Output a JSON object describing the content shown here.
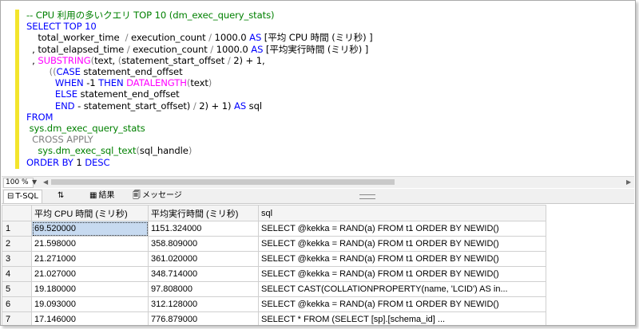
{
  "editor": {
    "lines": [
      [
        {
          "t": "-- CPU 利用の多いクエリ TOP 10 (dm_exec_query_stats)",
          "c": "c"
        }
      ],
      [
        {
          "t": "SELECT TOP 10",
          "c": "k"
        }
      ],
      [
        {
          "t": "    total_worker_time  ",
          "c": ""
        },
        {
          "t": "/",
          "c": "g"
        },
        {
          "t": " execution_count ",
          "c": ""
        },
        {
          "t": "/",
          "c": "g"
        },
        {
          "t": " 1000.0 ",
          "c": ""
        },
        {
          "t": "AS",
          "c": "k"
        },
        {
          "t": " [平均 CPU 時間 (ミリ秒) ]",
          "c": ""
        }
      ],
      [
        {
          "t": "  , total_elapsed_time ",
          "c": ""
        },
        {
          "t": "/",
          "c": "g"
        },
        {
          "t": " execution_count ",
          "c": ""
        },
        {
          "t": "/",
          "c": "g"
        },
        {
          "t": " 1000.0 ",
          "c": ""
        },
        {
          "t": "AS",
          "c": "k"
        },
        {
          "t": " [平均実行時間 (ミリ秒) ]",
          "c": ""
        }
      ],
      [
        {
          "t": "  , ",
          "c": ""
        },
        {
          "t": "SUBSTRING",
          "c": "f"
        },
        {
          "t": "(",
          "c": "g"
        },
        {
          "t": "text, ",
          "c": ""
        },
        {
          "t": "(",
          "c": "g"
        },
        {
          "t": "statement_start_offset ",
          "c": ""
        },
        {
          "t": "/",
          "c": "g"
        },
        {
          "t": " 2) + 1,",
          "c": ""
        }
      ],
      [
        {
          "t": "        ((",
          "c": "g"
        },
        {
          "t": "CASE",
          "c": "k"
        },
        {
          "t": " statement_end_offset",
          "c": ""
        }
      ],
      [
        {
          "t": "          WHEN",
          "c": "k"
        },
        {
          "t": " -1 ",
          "c": ""
        },
        {
          "t": "THEN",
          "c": "k"
        },
        {
          "t": " ",
          "c": ""
        },
        {
          "t": "DATALENGTH",
          "c": "f"
        },
        {
          "t": "(",
          "c": "g"
        },
        {
          "t": "text",
          "c": ""
        },
        {
          "t": ")",
          "c": "g"
        }
      ],
      [
        {
          "t": "          ELSE",
          "c": "k"
        },
        {
          "t": " statement_end_offset",
          "c": ""
        }
      ],
      [
        {
          "t": "          END",
          "c": "k"
        },
        {
          "t": " - statement_start_offset) ",
          "c": ""
        },
        {
          "t": "/",
          "c": "g"
        },
        {
          "t": " 2) + 1) ",
          "c": ""
        },
        {
          "t": "AS",
          "c": "k"
        },
        {
          "t": " sql",
          "c": ""
        }
      ],
      [
        {
          "t": "FROM",
          "c": "k"
        }
      ],
      [
        {
          "t": " sys.dm_exec_query_stats",
          "c": "s"
        }
      ],
      [
        {
          "t": "  ",
          "c": ""
        },
        {
          "t": "CROSS APPLY",
          "c": "g"
        }
      ],
      [
        {
          "t": "    sys.dm_exec_sql_text",
          "c": "s"
        },
        {
          "t": "(",
          "c": "g"
        },
        {
          "t": "sql_handle",
          "c": ""
        },
        {
          "t": ")",
          "c": "g"
        }
      ],
      [
        {
          "t": "ORDER BY",
          "c": "k"
        },
        {
          "t": " 1 ",
          "c": ""
        },
        {
          "t": "DESC",
          "c": "k"
        }
      ]
    ]
  },
  "zoom": {
    "value": "100 %"
  },
  "tabs": [
    {
      "icon": "⊟",
      "label": "T-SQL",
      "active": true
    },
    {
      "icon": "⇅",
      "label": "",
      "active": false
    },
    {
      "icon": "▦",
      "label": "結果",
      "active": false
    },
    {
      "icon": "🗐",
      "label": "メッセージ",
      "active": false
    }
  ],
  "results": {
    "columns": [
      "平均 CPU 時間 (ミリ秒)",
      "平均実行時間 (ミリ秒)",
      "sql"
    ],
    "rows": [
      [
        "1",
        "69.520000",
        "1151.324000",
        "SELECT @kekka = RAND(a) FROM t1 ORDER BY NEWID()"
      ],
      [
        "2",
        "21.598000",
        "358.809000",
        "SELECT @kekka = RAND(a) FROM t1 ORDER BY NEWID()"
      ],
      [
        "3",
        "21.271000",
        "361.020000",
        "SELECT @kekka = RAND(a) FROM t1 ORDER BY NEWID()"
      ],
      [
        "4",
        "21.027000",
        "348.714000",
        "SELECT @kekka = RAND(a) FROM t1 ORDER BY NEWID()"
      ],
      [
        "5",
        "19.180000",
        "97.808000",
        "SELECT CAST(COLLATIONPROPERTY(name, 'LCID') AS in..."
      ],
      [
        "6",
        "19.093000",
        "312.128000",
        "SELECT @kekka = RAND(a) FROM t1 ORDER BY NEWID()"
      ],
      [
        "7",
        "17.146000",
        "776.879000",
        "SELECT * FROM (SELECT          [sp].[schema_id]          ..."
      ]
    ]
  }
}
